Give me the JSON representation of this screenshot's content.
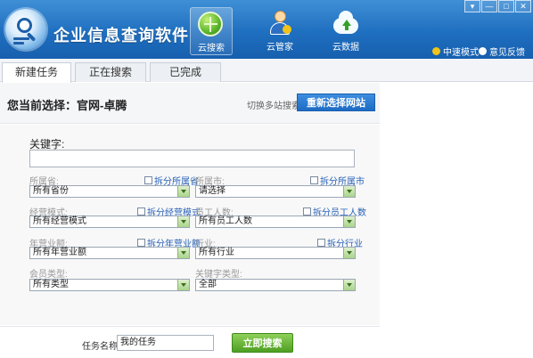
{
  "app": {
    "title": "企业信息查询软件"
  },
  "nav": [
    {
      "label": "云搜索",
      "icon": "globe-search-icon",
      "active": true
    },
    {
      "label": "云管家",
      "icon": "person-manager-icon",
      "active": false
    },
    {
      "label": "云数据",
      "icon": "cloud-upload-icon",
      "active": false
    }
  ],
  "window_controls": [
    "▾",
    "—",
    "□",
    "✕"
  ],
  "header_links": {
    "speed_mode": "中速模式",
    "feedback": "意见反馈"
  },
  "tabs": [
    {
      "label": "新建任务",
      "active": true
    },
    {
      "label": "正在搜索",
      "active": false
    },
    {
      "label": "已完成",
      "active": false
    }
  ],
  "selection": {
    "label": "您当前选择：官网-卓腾",
    "switch_label": "切换多站搜索",
    "reselect_button": "重新选择网站"
  },
  "form": {
    "keyword_label": "关键字:",
    "keyword_value": "",
    "fields": {
      "province": {
        "label": "所属省:",
        "split": "拆分所属省",
        "value": "所有省份"
      },
      "city": {
        "label": "所属市:",
        "split": "拆分所属市",
        "value": "请选择"
      },
      "business_mode": {
        "label": "经营模式:",
        "split": "拆分经营模式",
        "value": "所有经营模式"
      },
      "employees": {
        "label": "员工人数:",
        "split": "拆分员工人数",
        "value": "所有员工人数"
      },
      "revenue": {
        "label": "年营业额:",
        "split": "拆分年营业额",
        "value": "所有年营业额"
      },
      "industry": {
        "label": "行业:",
        "split": "拆分行业",
        "value": "所有行业"
      },
      "member_type": {
        "label": "会员类型:",
        "value": "所有类型"
      },
      "keyword_type": {
        "label": "关键字类型:",
        "value": "全部"
      }
    }
  },
  "bottom": {
    "task_name_label": "任务名称:",
    "task_name_value": "我的任务",
    "search_button": "立即搜索"
  },
  "colors": {
    "header_blue": "#1f6fc0",
    "button_blue": "#1d6bc4",
    "button_green": "#4e9f22",
    "link_blue": "#2a63b8"
  }
}
